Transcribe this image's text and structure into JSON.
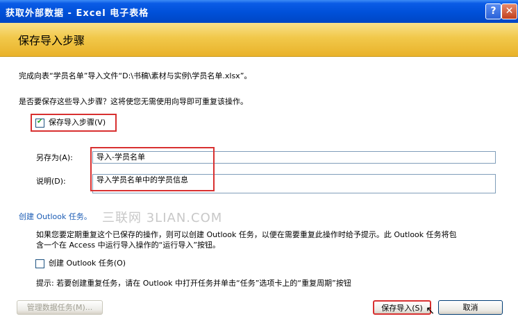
{
  "window": {
    "title": "获取外部数据 - Excel 电子表格",
    "help_glyph": "?",
    "close_glyph": "✕"
  },
  "banner": {
    "heading": "保存导入步骤"
  },
  "completion_text": "完成向表“学员名单”导入文件“D:\\书稿\\素材与实例\\学员名单.xlsx”。",
  "prompt_text": "是否要保存这些导入步骤？这将使您无需使用向导即可重复该操作。",
  "save_steps": {
    "label": "保存导入步骤(V)",
    "checked": true
  },
  "save_as": {
    "label": "另存为(A):",
    "value": "导入-学员名单"
  },
  "description": {
    "label": "说明(D):",
    "value": "导入学员名单中的学员信息"
  },
  "watermark": "三联网 3LIAN.COM",
  "outlook_task": {
    "heading": "创建 Outlook 任务。",
    "info_line1": "如果您要定期重复这个已保存的操作，则可以创建 Outlook 任务，以便在需要重复此操作时给予提示。此 Outlook 任务将包",
    "info_line2": "含一个在 Access 中运行导入操作的“运行导入”按钮。",
    "checkbox_label": "创建 Outlook 任务(O)",
    "checked": false,
    "hint": "提示: 若要创建重复任务，请在 Outlook 中打开任务并单击“任务”选项卡上的“重复周期”按钮"
  },
  "buttons": {
    "manage": "管理数据任务(M)...",
    "save_import": "保存导入(S)",
    "cancel": "取消"
  },
  "colors": {
    "title_blue": "#0050d8",
    "banner_gold": "#f1c84a",
    "highlight_red": "#d83030"
  }
}
